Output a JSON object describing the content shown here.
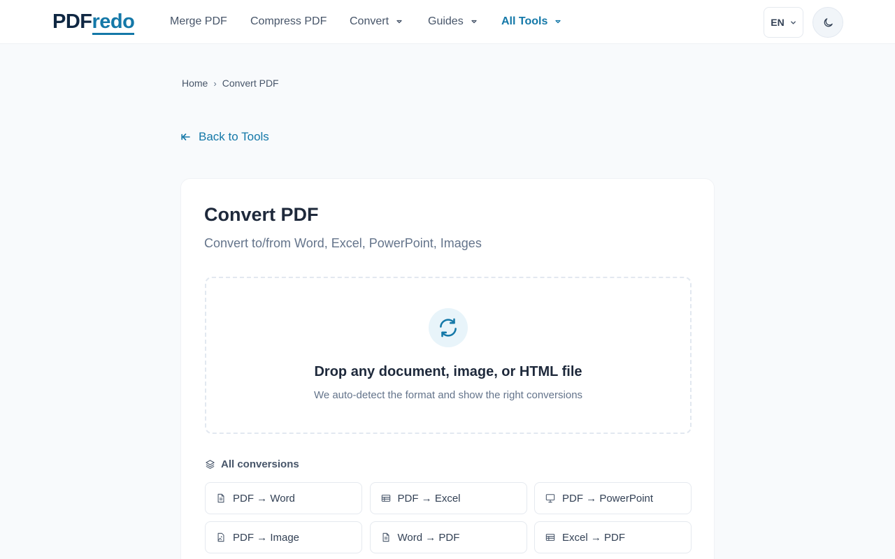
{
  "header": {
    "logo": {
      "part1": "PDF",
      "part2": "redo"
    },
    "nav": [
      {
        "label": "Merge PDF",
        "dropdown": false,
        "active": false
      },
      {
        "label": "Compress PDF",
        "dropdown": false,
        "active": false
      },
      {
        "label": "Convert",
        "dropdown": true,
        "active": false
      },
      {
        "label": "Guides",
        "dropdown": true,
        "active": false
      },
      {
        "label": "All Tools",
        "dropdown": true,
        "active": true
      }
    ],
    "language": "EN",
    "theme_icon": "moon-icon"
  },
  "breadcrumb": {
    "home": "Home",
    "separator": "›",
    "current": "Convert PDF"
  },
  "back_link": {
    "label": "Back to Tools",
    "icon": "arrow-left-icon"
  },
  "card": {
    "title": "Convert PDF",
    "subtitle": "Convert to/from Word, Excel, PowerPoint, Images",
    "dropzone": {
      "icon": "refresh-icon",
      "title": "Drop any document, image, or HTML file",
      "subtitle": "We auto-detect the format and show the right conversions"
    },
    "conversions_heading": "All conversions",
    "conversions": [
      {
        "label": "PDF → Word",
        "icon": "document-icon"
      },
      {
        "label": "PDF → Excel",
        "icon": "spreadsheet-icon"
      },
      {
        "label": "PDF → PowerPoint",
        "icon": "presentation-icon"
      },
      {
        "label": "PDF → Image",
        "icon": "image-file-icon"
      },
      {
        "label": "Word → PDF",
        "icon": "document-icon"
      },
      {
        "label": "Excel → PDF",
        "icon": "spreadsheet-icon"
      }
    ]
  },
  "colors": {
    "accent": "#1478a8",
    "logo_dark": "#0f2742",
    "background": "#f8fafc",
    "text": "#1e293b",
    "muted": "#64748b"
  }
}
